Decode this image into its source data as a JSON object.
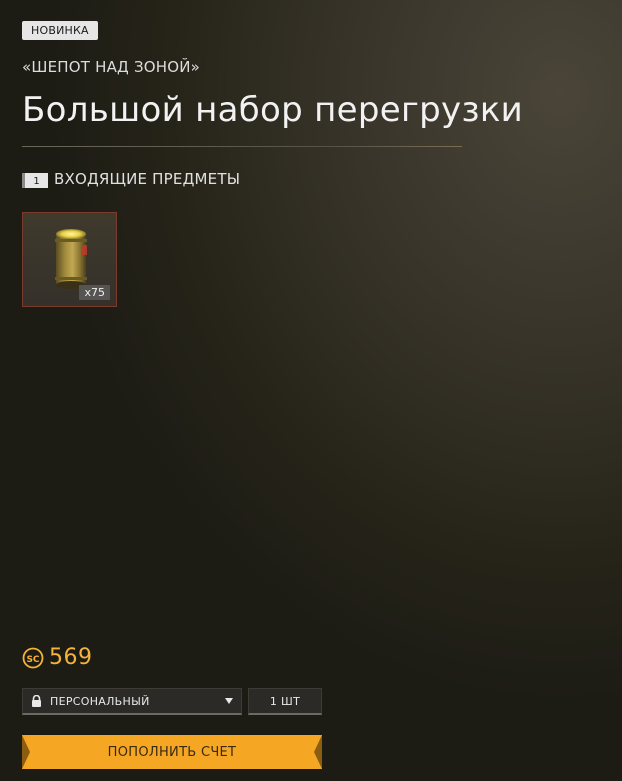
{
  "badge": "НОВИНКА",
  "subtitle": "«ШЕПОТ НАД ЗОНОЙ»",
  "title": "Большой набор перегрузки",
  "items_section": {
    "count": "1",
    "label": "ВХОДЯЩИЕ ПРЕДМЕТЫ",
    "items": [
      {
        "icon": "canister-icon",
        "quantity": "x75"
      }
    ]
  },
  "price": {
    "currency_icon": "sc-coin-icon",
    "value": "569",
    "color": "#f5b33a"
  },
  "controls": {
    "type_select": {
      "icon": "lock-icon",
      "value": "ПЕРСОНАЛЬНЫЙ",
      "chevron": "chevron-down-icon"
    },
    "quantity": "1 ШТ"
  },
  "topup_button": {
    "label": "ПОПОЛНИТЬ СЧЕТ",
    "color": "#f5a623"
  }
}
